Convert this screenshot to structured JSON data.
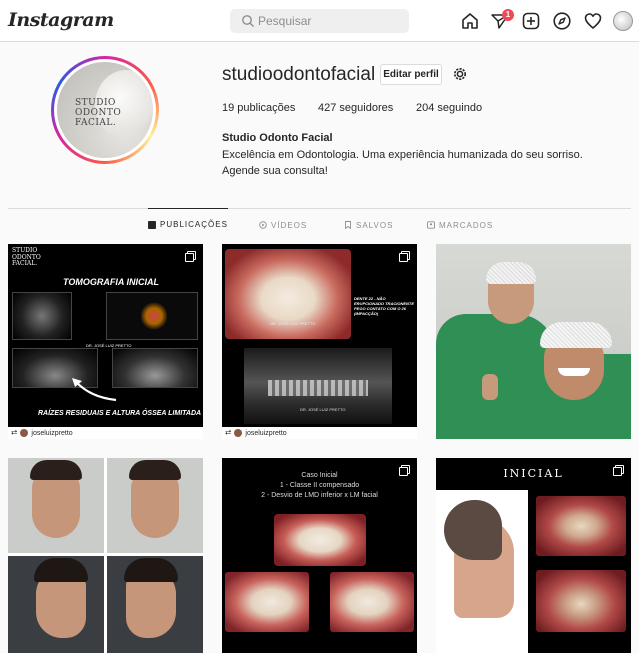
{
  "nav": {
    "logo": "Instagram",
    "search_placeholder": "Pesquisar",
    "notification_count": "1"
  },
  "profile": {
    "username": "studioodontofacial",
    "edit_button": "Editar perfil",
    "stats": {
      "posts": "19 publicações",
      "followers": "427 seguidores",
      "following": "204 seguindo"
    },
    "full_name": "Studio Odonto Facial",
    "bio_lines": [
      "Excelência em Odontologia. Uma experiência humanizada do seu sorriso.",
      "Agende sua consulta!"
    ],
    "avatar_text": [
      "STUDIO",
      "ODONTO",
      "FACIAL."
    ]
  },
  "tabs": [
    {
      "label": "PUBLICAÇÕES",
      "active": true
    },
    {
      "label": "VÍDEOS",
      "active": false
    },
    {
      "label": "SALVOS",
      "active": false
    },
    {
      "label": "MARCADOS",
      "active": false
    }
  ],
  "posts": {
    "p1": {
      "brand": [
        "STUDIO",
        "ODONTO",
        "FACIAL."
      ],
      "title": "TOMOGRAFIA INICIAL",
      "caption": "RAÍZES RESIDUAIS E ALTURA ÓSSEA LIMITADA",
      "credit": "DR. JOSÉ LUIZ PRETTO",
      "tag": "joseluizpretto"
    },
    "p2": {
      "note": "DENTE 22 - NÃO ERUPCIONADO TRACIONENTE PEGO CONTATO COM O 26 (IMPACÇÃO)",
      "credit": "DR. JOSÉ LUIZ PRETTO",
      "tag": "joseluizpretto"
    },
    "p5": {
      "title": "Caso Inicial",
      "line1": "1 - Classe II compensado",
      "line2": "2 - Desvio de LMD inferior x LM facial"
    },
    "p6": {
      "title": "INICIAL"
    }
  },
  "colors": {
    "accent_badge": "#ed4956",
    "border": "#dbdbdb",
    "surgery_green": "#2f8f55"
  }
}
